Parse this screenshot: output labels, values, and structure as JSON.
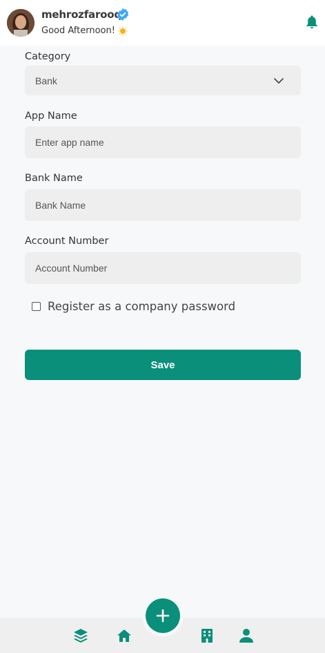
{
  "header": {
    "username": "mehrozfarooq",
    "greeting": "Good Afternoon!",
    "icons": [
      "verified-badge-icon",
      "sun-icon",
      "bell-icon"
    ]
  },
  "form": {
    "category": {
      "label": "Category",
      "value": "Bank"
    },
    "app_name": {
      "label": "App Name",
      "placeholder": "Enter app name"
    },
    "bank_name": {
      "label": "Bank Name",
      "placeholder": "Bank Name"
    },
    "account_number": {
      "label": "Account Number",
      "placeholder": "Account Number"
    },
    "company_checkbox": {
      "label": "Register as a company password",
      "checked": false
    },
    "save_label": "Save"
  },
  "nav": {
    "items": [
      "layers-icon",
      "home-icon",
      "add-icon",
      "building-icon",
      "profile-icon"
    ]
  },
  "colors": {
    "accent": "#0a8f7a",
    "field_bg": "#eeeeee",
    "page_bg": "#f7f8fa"
  }
}
